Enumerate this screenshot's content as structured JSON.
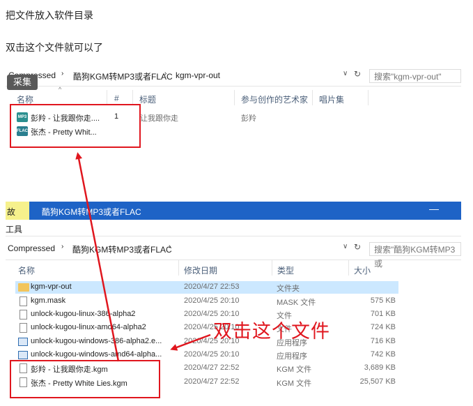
{
  "intro": {
    "line1": "把文件放入软件目录",
    "line2": "双击这个文件就可以了"
  },
  "capture_badge": "采集",
  "window1": {
    "breadcrumb": [
      "Compressed",
      "酷狗KGM转MP3或者FLAC",
      "kgm-vpr-out"
    ],
    "search_placeholder": "搜索\"kgm-vpr-out\"",
    "columns": [
      "名称",
      "#",
      "标题",
      "参与创作的艺术家",
      "唱片集"
    ],
    "rows": [
      {
        "name": "彭羚 - 让我跟你走....",
        "num": "1",
        "title": "让我跟你走",
        "artist": "彭羚",
        "icon": "mp3-file-icon",
        "icon_text": "MP3"
      },
      {
        "name": "张杰 - Pretty Whit...",
        "num": "",
        "title": "",
        "artist": "",
        "icon": "flac-file-icon",
        "icon_text": "FLAC"
      }
    ]
  },
  "window2": {
    "title_left": "故",
    "title": "酷狗KGM转MP3或者FLAC",
    "toolbar_label": "工具",
    "breadcrumb": [
      "Compressed",
      "酷狗KGM转MP3或者FLAC"
    ],
    "search_placeholder": "搜索\"酷狗KGM转MP3或",
    "columns": [
      "名称",
      "修改日期",
      "类型",
      "大小"
    ],
    "rows": [
      {
        "name": "kgm-vpr-out",
        "date": "2020/4/27 22:53",
        "type": "文件夹",
        "size": "",
        "icon": "folder-icon"
      },
      {
        "name": "kgm.mask",
        "date": "2020/4/25 20:10",
        "type": "MASK 文件",
        "size": "575 KB",
        "icon": "file-icon"
      },
      {
        "name": "unlock-kugou-linux-386-alpha2",
        "date": "2020/4/25 20:10",
        "type": "文件",
        "size": "701 KB",
        "icon": "file-icon"
      },
      {
        "name": "unlock-kugou-linux-amd64-alpha2",
        "date": "2020/4/25 20:10",
        "type": "文件",
        "size": "724 KB",
        "icon": "file-icon"
      },
      {
        "name": "unlock-kugou-windows-386-alpha2.e...",
        "date": "2020/4/25 20:10",
        "type": "应用程序",
        "size": "716 KB",
        "icon": "exe-icon"
      },
      {
        "name": "unlock-kugou-windows-amd64-alpha...",
        "date": "2020/4/25 20:10",
        "type": "应用程序",
        "size": "742 KB",
        "icon": "exe-icon"
      },
      {
        "name": "彭羚 - 让我跟你走.kgm",
        "date": "2020/4/27 22:52",
        "type": "KGM 文件",
        "size": "3,689 KB",
        "icon": "file-icon"
      },
      {
        "name": "张杰 - Pretty White Lies.kgm",
        "date": "2020/4/27 22:52",
        "type": "KGM 文件",
        "size": "25,507 KB",
        "icon": "file-icon"
      }
    ]
  },
  "annotation": "双击这个文件",
  "colors": {
    "accent_blue": "#1e63c6",
    "annotation_red": "#e0161e",
    "selected_row": "#cce8ff"
  }
}
